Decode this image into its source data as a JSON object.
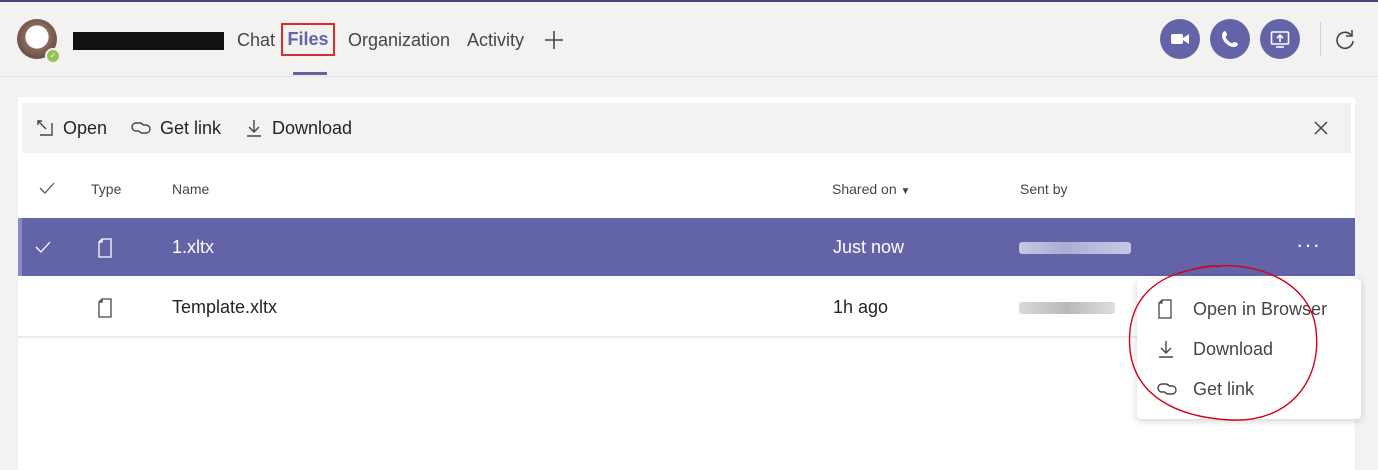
{
  "header": {
    "tabs": [
      {
        "label": "Chat"
      },
      {
        "label": "Files"
      },
      {
        "label": "Organization"
      },
      {
        "label": "Activity"
      }
    ],
    "icons": [
      "add-tab-icon",
      "video-call-icon",
      "audio-call-icon",
      "share-screen-icon",
      "refresh-icon"
    ]
  },
  "toolbar": {
    "open_label": "Open",
    "get_link_label": "Get link",
    "download_label": "Download"
  },
  "table": {
    "columns": {
      "type": "Type",
      "name": "Name",
      "shared_on": "Shared on",
      "sent_by": "Sent by"
    },
    "rows": [
      {
        "name": "1.xltx",
        "shared_on": "Just now",
        "selected": true
      },
      {
        "name": "Template.xltx",
        "shared_on": "1h ago",
        "selected": false
      }
    ]
  },
  "context_menu": {
    "items": [
      {
        "label": "Open in Browser",
        "icon": "file-icon"
      },
      {
        "label": "Download",
        "icon": "download-icon"
      },
      {
        "label": "Get link",
        "icon": "link-icon"
      }
    ]
  },
  "colors": {
    "accent": "#6264a7",
    "highlight_box": "#d32f2f",
    "annotation": "#d0021b",
    "presence": "#92c353"
  }
}
